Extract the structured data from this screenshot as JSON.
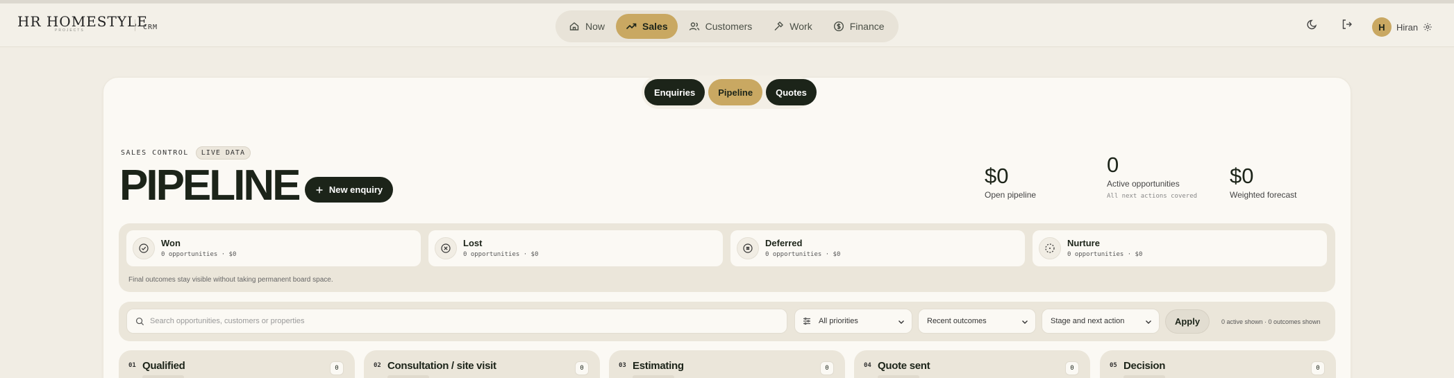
{
  "header": {
    "logo": "HR HOMESTYLE",
    "logo_sub": "PROJECTS",
    "product": "CRM",
    "nav": [
      {
        "label": "Now",
        "icon": "home-icon"
      },
      {
        "label": "Sales",
        "icon": "trending-up-icon",
        "active": true
      },
      {
        "label": "Customers",
        "icon": "users-icon"
      },
      {
        "label": "Work",
        "icon": "hammer-icon"
      },
      {
        "label": "Finance",
        "icon": "dollar-circle-icon"
      }
    ],
    "user": {
      "initial": "H",
      "name": "Hiran"
    }
  },
  "subtabs": [
    {
      "label": "Enquiries"
    },
    {
      "label": "Pipeline",
      "active": true
    },
    {
      "label": "Quotes"
    }
  ],
  "page": {
    "eyebrow": "SALES CONTROL",
    "live_badge": "LIVE DATA",
    "title": "PIPELINE",
    "new_button": "New enquiry"
  },
  "stats": [
    {
      "value": "$0",
      "label": "Open pipeline"
    },
    {
      "value": "0",
      "label": "Active opportunities",
      "sub": "All next actions covered"
    },
    {
      "value": "$0",
      "label": "Weighted forecast"
    }
  ],
  "outcomes": {
    "items": [
      {
        "name": "Won",
        "meta": "0 opportunities · $0",
        "icon": "check-circle-icon"
      },
      {
        "name": "Lost",
        "meta": "0 opportunities · $0",
        "icon": "x-circle-icon"
      },
      {
        "name": "Deferred",
        "meta": "0 opportunities · $0",
        "icon": "pause-circle-icon"
      },
      {
        "name": "Nurture",
        "meta": "0 opportunities · $0",
        "icon": "dashed-circle-icon"
      }
    ],
    "note": "Final outcomes stay visible without taking permanent board space."
  },
  "filters": {
    "search_placeholder": "Search opportunities, customers or properties",
    "priority": "All priorities",
    "outcomes": "Recent outcomes",
    "sort": "Stage and next action",
    "apply": "Apply",
    "status": "0 active shown · 0 outcomes shown"
  },
  "columns": [
    {
      "num": "01",
      "title": "Qualified",
      "count": "0"
    },
    {
      "num": "02",
      "title": "Consultation / site visit",
      "count": "0"
    },
    {
      "num": "03",
      "title": "Estimating",
      "count": "0"
    },
    {
      "num": "04",
      "title": "Quote sent",
      "count": "0"
    },
    {
      "num": "05",
      "title": "Decision",
      "count": "0"
    }
  ],
  "colors": {
    "accent": "#c9a862",
    "dark": "#1c2419",
    "background": "#f1ede4"
  }
}
